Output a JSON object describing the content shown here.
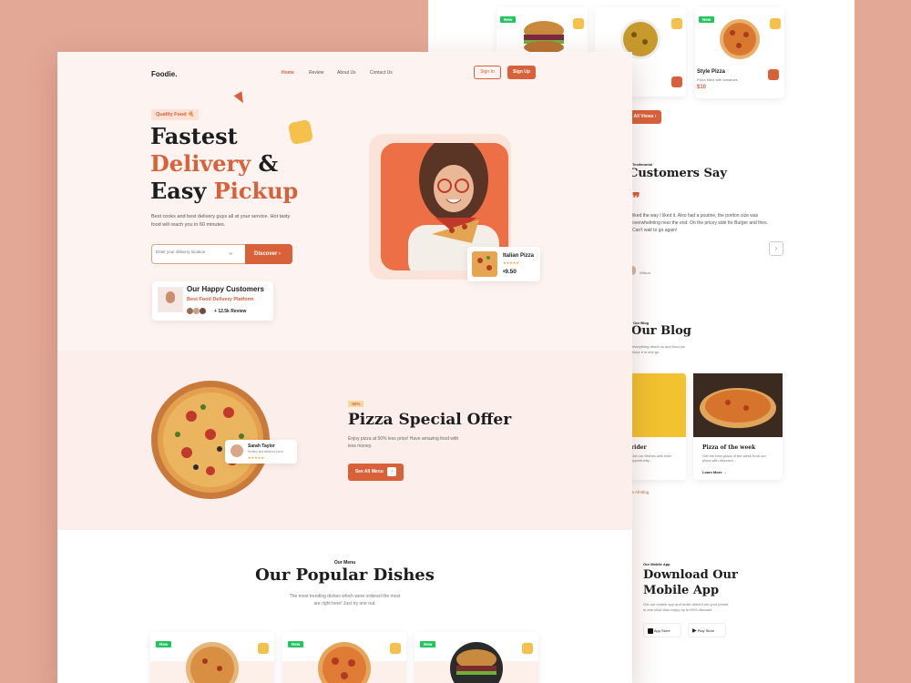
{
  "back": {
    "dish_name": "Style Pizza",
    "dish_desc": "Pizza filled with tomatoes",
    "dish_price": "$10",
    "view_all": "All Views",
    "testimonial_label": "Testimonial",
    "testimonial_title": "Customers Say",
    "testimonial_text": "liked the way I liked it. Also had a poutine, the portion size was overwhelming near the end. On the pricey side for Burger and fries. Can't wait to go again!",
    "testimonial_name": "Wilson",
    "blog_label": "Our Blog",
    "blog_title": "Our Blog",
    "blog_desc": "everything about us and food we have it in one go",
    "blog_post1_title": "rider",
    "blog_post1_text": "Get our Dishes with rider opportunity...",
    "blog_post2_title": "Pizza of the week",
    "blog_post2_text": "Get the best pizza of the week from our pizza with discount...",
    "learn_more": "Learn More",
    "see_all_blog": "See All Blog",
    "app_label": "Our Mobile App",
    "app_title_1": "Download Our",
    "app_title_2": "Mobile App",
    "app_desc": "Get our mobile app and order direct from your phone in one click! Also enjoy up to 50% discount",
    "app_store": "App Store",
    "play_store": "Play Store"
  },
  "nav": {
    "logo": "Foodie.",
    "links": [
      "Home",
      "Review",
      "About Us",
      "Contact Us"
    ],
    "sign_in": "Sign In",
    "sign_up": "Sign Up"
  },
  "hero": {
    "badge": "Quality Food",
    "title_1": "Fastest",
    "title_2a": "Delivery",
    "title_2b": "&",
    "title_3a": "Easy",
    "title_3b": "Pickup",
    "desc": "Best cooks and best delivery guys all at your service. Hot tasty food will reach you in 60 minutes.",
    "search_placeholder": "Enter your delivery location",
    "discover": "Discover",
    "customers_title": "Our Happy Customers",
    "customers_sub": "Best Food Delivery Platform",
    "review_count": "12.5k Review",
    "review_prefix": "+",
    "card_name": "Italian Pizza",
    "card_price": "9.50",
    "card_currency": "$"
  },
  "offer": {
    "discount": "-50%",
    "title": "Pizza Special Offer",
    "desc": "Enjoy pizza at 50% less price! Have amazing food with less money.",
    "cta": "See All Menu",
    "reviewer_name": "Sarah Taylor",
    "reviewer_text": "Healthy and delicious pizza"
  },
  "menu": {
    "label": "Our Menu",
    "title": "Our Popular Dishes",
    "desc_1": "The most trending dishes which were ordered the most",
    "desc_2": "are right here! Just try one out.",
    "new_tag": "New"
  },
  "colors": {
    "accent": "#d8613a",
    "background": "#e3a896",
    "hero_bg": "#fdf3f0",
    "star": "#f5a623",
    "new_tag": "#22c55e"
  }
}
